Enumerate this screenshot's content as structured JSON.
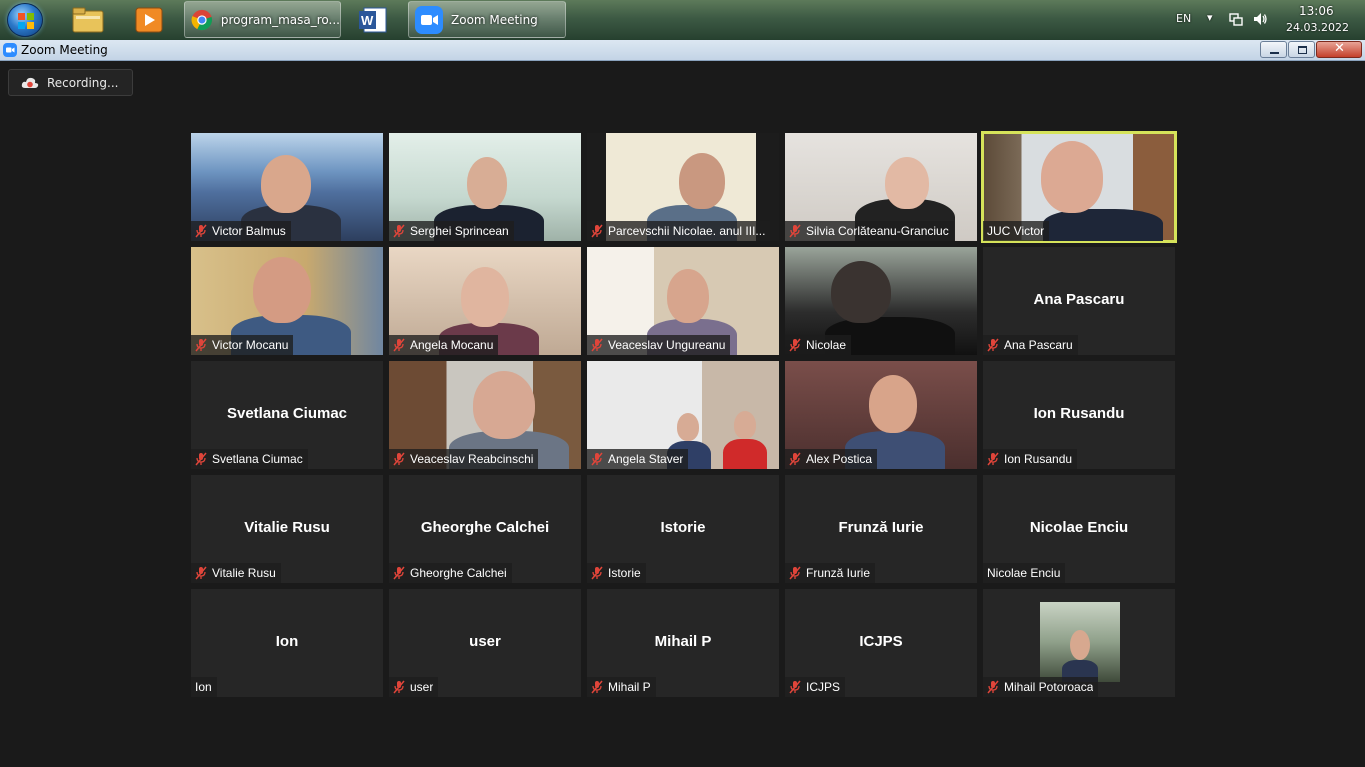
{
  "taskbar": {
    "buttons": [
      {
        "label": "program_masa_ro..."
      },
      {
        "label": "Zoom Meeting"
      }
    ],
    "language": "EN",
    "time": "13:06",
    "date": "24.03.2022"
  },
  "window": {
    "title": "Zoom Meeting"
  },
  "recording": {
    "label": "Recording..."
  },
  "participants": [
    {
      "name": "Victor Balmus",
      "video": true,
      "muted": true
    },
    {
      "name": "Serghei Sprincean",
      "video": true,
      "muted": true
    },
    {
      "name": "Parcevschii Nicolae. anul III...",
      "video": true,
      "muted": true
    },
    {
      "name": "Silvia Corlăteanu-Granciuc",
      "video": true,
      "muted": true
    },
    {
      "name": "JUC Victor",
      "video": true,
      "muted": false,
      "speaking": true
    },
    {
      "name": "Victor  Mocanu",
      "video": true,
      "muted": true
    },
    {
      "name": "Angela Mocanu",
      "video": true,
      "muted": true
    },
    {
      "name": "Veaceslav Ungureanu",
      "video": true,
      "muted": true
    },
    {
      "name": "Nicolae",
      "video": true,
      "muted": true
    },
    {
      "name": "Ana Pascaru",
      "video": false,
      "muted": true
    },
    {
      "name": "Svetlana Ciumac",
      "video": false,
      "muted": true
    },
    {
      "name": "Veaceslav Reabcinschi",
      "video": true,
      "muted": true
    },
    {
      "name": "Angela Staver",
      "video": true,
      "muted": true
    },
    {
      "name": "Alex Postica",
      "video": true,
      "muted": true
    },
    {
      "name": "Ion Rusandu",
      "video": false,
      "muted": true
    },
    {
      "name": "Vitalie Rusu",
      "video": false,
      "muted": true
    },
    {
      "name": "Gheorghe Calchei",
      "video": false,
      "muted": true
    },
    {
      "name": "Istorie",
      "video": false,
      "muted": true
    },
    {
      "name": "Frunză Iurie",
      "video": false,
      "muted": true
    },
    {
      "name": "Nicolae Enciu",
      "video": false,
      "muted": false
    },
    {
      "name": "Ion",
      "video": false,
      "muted": false
    },
    {
      "name": "user",
      "video": false,
      "muted": true
    },
    {
      "name": "Mihail P",
      "video": false,
      "muted": true
    },
    {
      "name": "ICJPS",
      "video": false,
      "muted": true
    },
    {
      "name": "Mihail Potoroaca",
      "video": false,
      "muted": true,
      "avatar_photo": true
    }
  ],
  "colors": {
    "speaking_border": "#d6e35a",
    "mute_icon": "#e0453a",
    "tile_bg": "#262626",
    "app_bg": "#1a1a1a"
  }
}
